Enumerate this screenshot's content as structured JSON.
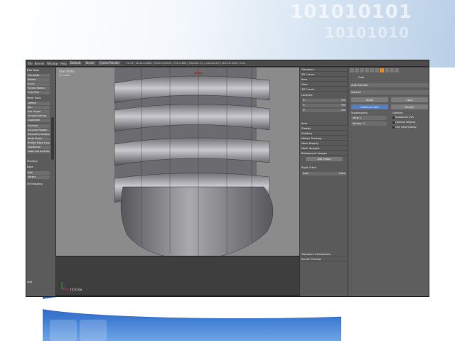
{
  "slide": {
    "binary_line1": "101010101",
    "binary_line2": "10101010"
  },
  "topbar": {
    "menus": [
      "File",
      "Render",
      "Window",
      "Help"
    ],
    "layout_value": "Default",
    "scene_value": "Scene",
    "engine_value": "Cycles Render",
    "stats": "v2.76 | Verts:0/2860 | Faces:0/2840 | Tris:5,680 | Objects:1/1 | Lamps:0/0 | Mem:6.42M | Crea"
  },
  "toolshelf": {
    "heading": "Edit Tools",
    "items": [
      "Translate",
      "Rotate",
      "Scale",
      "Shrink/Fatten",
      "Push/Pull",
      "Mesh Tools",
      "Delete",
      "Join",
      "Set Origin",
      "Smooth Vertex",
      "Duplicate",
      "Extrude",
      "Extrude Region",
      "Extrude Individual",
      "Inset Faces",
      "Bridge Edge Loops",
      "Subdivide",
      "Loop Cut and Slide"
    ],
    "lower_items": [
      "Shading",
      "Data",
      "UV Mapping",
      "Add"
    ],
    "fields": [
      "Edit",
      "Vertex"
    ]
  },
  "viewport": {
    "view_label": "User Ortho",
    "sub_label": "(1) Cube",
    "object_label": "(1) Crea"
  },
  "npanel": {
    "rows": [
      "Transform",
      "3D Cursor",
      "Item",
      "View",
      "3D Cursor"
    ],
    "location_label": "Location:",
    "fields": [
      {
        "axis": "X:",
        "value": "0m"
      },
      {
        "axis": "Y:",
        "value": "0m"
      },
      {
        "axis": "Z:",
        "value": "0m"
      }
    ],
    "lower_rows": [
      "Item",
      "Display",
      "Shading",
      "Motion Tracking",
      "Mesh Display",
      "Mesh Analysis",
      "Background Images"
    ],
    "add_image_label": "Add Image",
    "view_row": "Right Ortho",
    "axis_label": "Axis",
    "front_value": "Front",
    "bottom_rows": [
      "Transform Orientations",
      "Screen Preview"
    ]
  },
  "props": {
    "object_name": "Crea",
    "data_label": "Auto Smooth",
    "buttons": [
      "Apply",
      "Copy"
    ],
    "subtabs": [
      "Catmull-Clark",
      "Simple"
    ],
    "subdivisions_label": "Subdivisions:",
    "options_label": "Options:",
    "view_field": "View: 1",
    "render_field": "Render: 2",
    "checks": [
      "Subdivide UVs",
      "Optimal Display",
      "Use OpenSubdiv"
    ],
    "modifier_name": "Subsurf"
  },
  "colors": {
    "accent": "#e08b2b",
    "selected_edge": "#e8a040",
    "active_button": "#5680c2"
  }
}
